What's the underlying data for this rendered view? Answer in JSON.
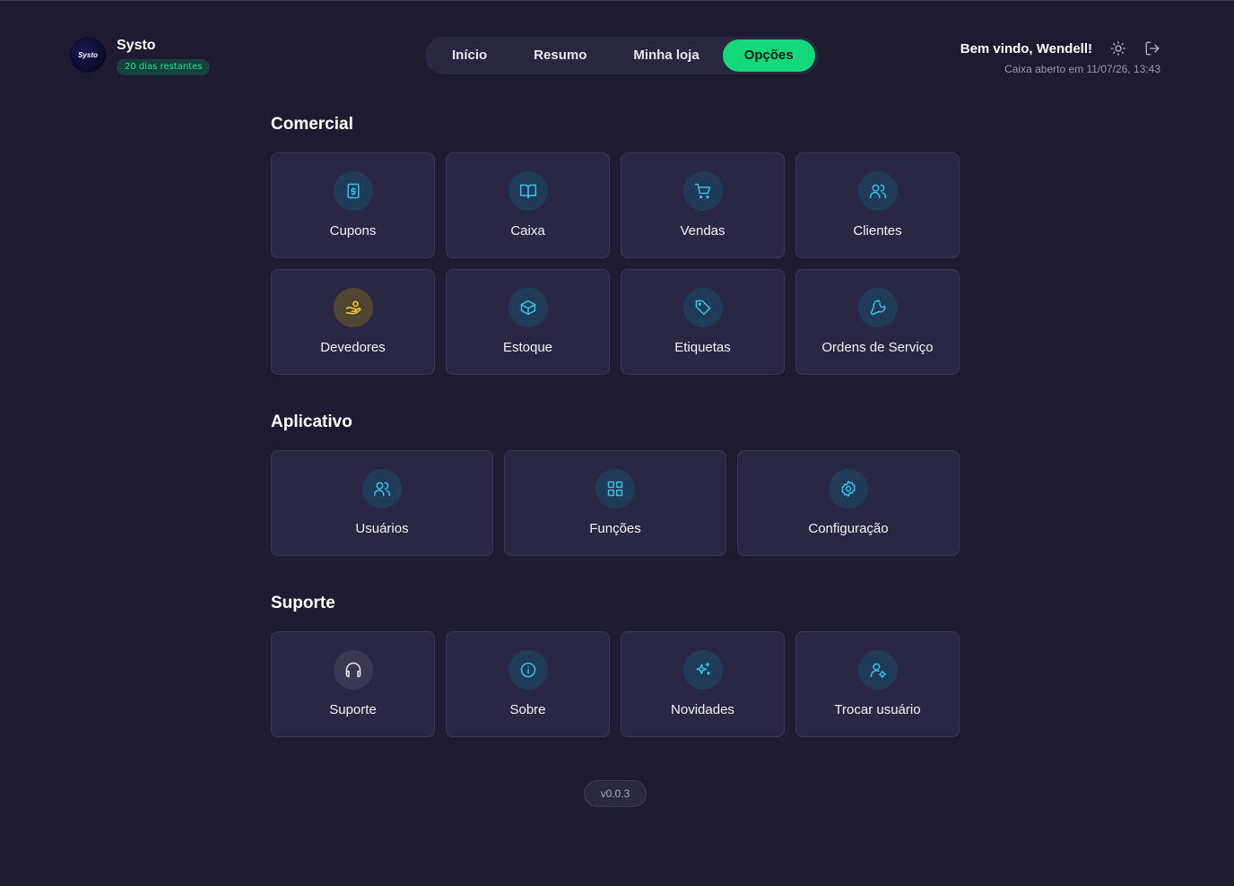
{
  "brand": {
    "name": "Systo",
    "trial": "20 dias restantes",
    "logo_text": "Systo"
  },
  "nav": {
    "items": [
      {
        "label": "Início",
        "active": false
      },
      {
        "label": "Resumo",
        "active": false
      },
      {
        "label": "Minha loja",
        "active": false
      },
      {
        "label": "Opções",
        "active": true
      }
    ]
  },
  "user": {
    "welcome": "Bem vindo, Wendell!",
    "caixa": "Caixa aberto em 11/07/26, 13:43",
    "theme_icon": "sun-icon",
    "logout_icon": "logout-icon"
  },
  "colors": {
    "accent": "#14d97a",
    "icon": "#38c1e6",
    "warning": "#f4cf25",
    "background": "#1e1b31",
    "card": "#2a2744"
  },
  "sections": [
    {
      "title": "Comercial",
      "cards": [
        {
          "label": "Cupons",
          "icon": "receipt-icon"
        },
        {
          "label": "Caixa",
          "icon": "book-open-icon"
        },
        {
          "label": "Vendas",
          "icon": "cart-icon"
        },
        {
          "label": "Clientes",
          "icon": "users-icon"
        },
        {
          "label": "Devedores",
          "icon": "hand-coins-icon"
        },
        {
          "label": "Estoque",
          "icon": "box-icon"
        },
        {
          "label": "Etiquetas",
          "icon": "tag-icon"
        },
        {
          "label": "Ordens de Serviço",
          "icon": "wrench-icon"
        }
      ]
    },
    {
      "title": "Aplicativo",
      "cards": [
        {
          "label": "Usuários",
          "icon": "users-icon"
        },
        {
          "label": "Funções",
          "icon": "grid-icon"
        },
        {
          "label": "Configuração",
          "icon": "gear-icon"
        }
      ]
    },
    {
      "title": "Suporte",
      "cards": [
        {
          "label": "Suporte",
          "icon": "headphones-icon"
        },
        {
          "label": "Sobre",
          "icon": "info-icon"
        },
        {
          "label": "Novidades",
          "icon": "sparkles-icon"
        },
        {
          "label": "Trocar usuário",
          "icon": "user-cog-icon"
        }
      ]
    }
  ],
  "version": "v0.0.3"
}
